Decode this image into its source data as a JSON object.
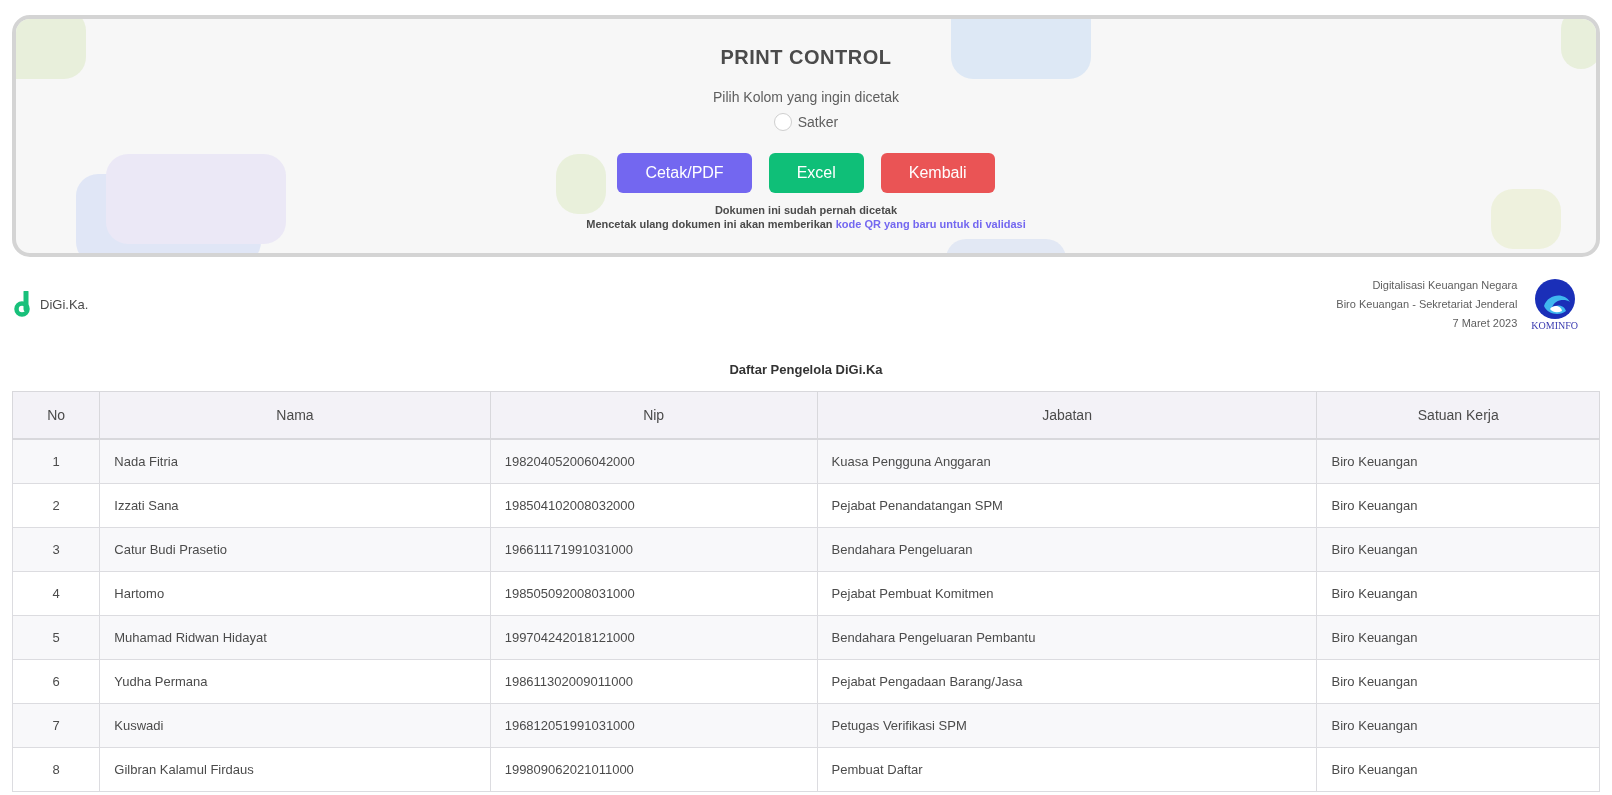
{
  "print_control": {
    "title": "PRINT CONTROL",
    "subtitle": "Pilih Kolom yang ingin dicetak",
    "options": [
      {
        "label": "Satker",
        "selected": false
      }
    ],
    "buttons": [
      {
        "label": "Cetak/PDF",
        "kind": "primary"
      },
      {
        "label": "Excel",
        "kind": "success"
      },
      {
        "label": "Kembali",
        "kind": "danger"
      }
    ],
    "notice": "Dokumen ini sudah pernah dicetak",
    "notice_detail": "Mencetak ulang dokumen ini akan memberikan",
    "notice_link": "kode QR yang baru untuk di validasi"
  },
  "header": {
    "brand": "DiGi.Ka.",
    "org_lines": [
      "Digitalisasi Keuangan Negara",
      "Biro Keuangan - Sekretariat Jenderal",
      "7 Maret 2023"
    ],
    "logo_caption": "KOMINFO"
  },
  "table": {
    "title": "Daftar Pengelola DiGi.Ka",
    "columns": [
      "No",
      "Nama",
      "Nip",
      "Jabatan",
      "Satuan Kerja"
    ],
    "rows": [
      [
        "1",
        "Nada Fitria",
        "198204052006042000",
        "Kuasa Pengguna Anggaran",
        "Biro Keuangan"
      ],
      [
        "2",
        "Izzati Sana",
        "198504102008032000",
        "Pejabat Penandatangan SPM",
        "Biro Keuangan"
      ],
      [
        "3",
        "Catur Budi Prasetio",
        "196611171991031000",
        "Bendahara Pengeluaran",
        "Biro Keuangan"
      ],
      [
        "4",
        "Hartomo",
        "198505092008031000",
        "Pejabat Pembuat Komitmen",
        "Biro Keuangan"
      ],
      [
        "5",
        "Muhamad Ridwan Hidayat",
        "199704242018121000",
        "Bendahara Pengeluaran Pembantu",
        "Biro Keuangan"
      ],
      [
        "6",
        "Yudha Permana",
        "198611302009011000",
        "Pejabat Pengadaan Barang/Jasa",
        "Biro Keuangan"
      ],
      [
        "7",
        "Kuswadi",
        "196812051991031000",
        "Petugas Verifikasi SPM",
        "Biro Keuangan"
      ],
      [
        "8",
        "Gilbran Kalamul Firdaus",
        "199809062021011000",
        "Pembuat Daftar",
        "Biro Keuangan"
      ]
    ]
  }
}
